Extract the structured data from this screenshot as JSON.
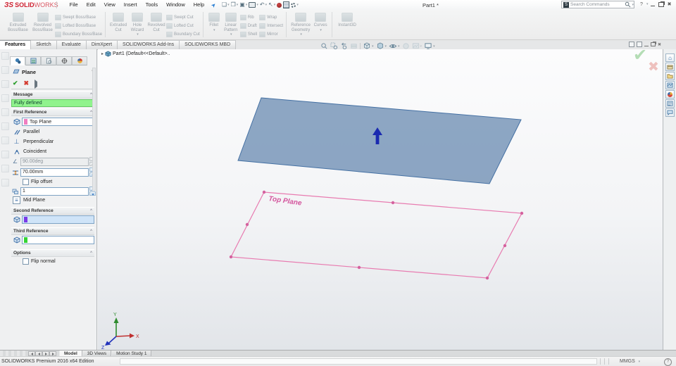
{
  "titlebar": {
    "logo_text_bold": "SOLID",
    "logo_text_light": "WORKS",
    "menus": {
      "file": "File",
      "edit": "Edit",
      "view": "View",
      "insert": "Insert",
      "tools": "Tools",
      "window": "Window",
      "help": "Help"
    },
    "document_title": "Part1 *",
    "search_placeholder": "Search Commands"
  },
  "ribbon": {
    "g1b1l1": "Extruded",
    "g1b1l2": "Boss/Base",
    "g1b2l1": "Revolved",
    "g1b2l2": "Boss/Base",
    "g1s1": "Swept Boss/Base",
    "g1s2": "Lofted Boss/Base",
    "g1s3": "Boundary Boss/Base",
    "g2b1l1": "Extruded",
    "g2b1l2": "Cut",
    "g2b2l1": "Hole",
    "g2b2l2": "Wizard",
    "g2b3l1": "Revolved",
    "g2b3l2": "Cut",
    "g2s1": "Swept Cut",
    "g2s2": "Lofted Cut",
    "g2s3": "Boundary Cut",
    "g3b1": "Fillet",
    "g3b2l1": "Linear",
    "g3b2l2": "Pattern",
    "g3s1": "Rib",
    "g3s2": "Draft",
    "g3s3": "Shell",
    "g3t1": "Wrap",
    "g3t2": "Intersect",
    "g3t3": "Mirror",
    "g4b1l1": "Reference",
    "g4b1l2": "Geometry",
    "g4b2": "Curves",
    "g5b1": "Instant3D"
  },
  "command_tabs": {
    "t1": "Features",
    "t2": "Sketch",
    "t3": "Evaluate",
    "t4": "DimXpert",
    "t5": "SOLIDWORKS Add-Ins",
    "t6": "SOLIDWORKS MBD"
  },
  "property_manager": {
    "title": "Plane",
    "message_header": "Message",
    "message_text": "Fully defined",
    "first_reference_header": "First Reference",
    "first_reference_value": "Top Plane",
    "parallel": "Parallel",
    "perpendicular": "Perpendicular",
    "coincident": "Coincident",
    "angle_value": "90.00deg",
    "distance_value": "70.00mm",
    "flip_offset": "Flip offset",
    "count_value": "1",
    "mid_plane": "Mid Plane",
    "second_reference_header": "Second Reference",
    "third_reference_header": "Third Reference",
    "options_header": "Options",
    "flip_normal": "Flip normal"
  },
  "feature_tree": {
    "root": "Part1  (Default<<Default>.."
  },
  "viewport": {
    "plane_label": "Top Plane",
    "axis_x": "X",
    "axis_y": "Y",
    "axis_z": "Z"
  },
  "bottom_tabs": {
    "model": "Model",
    "views3d": "3D Views",
    "motion": "Motion Study 1"
  },
  "status_bar": {
    "edition": "SOLIDWORKS Premium 2016 x64 Edition",
    "units": "MMGS"
  },
  "icons": {
    "collapse": "^",
    "dropdown": "▾",
    "flyout": "▸",
    "ok": "✔",
    "cancel": "✖",
    "help": "?",
    "perpendicular_glyph": "⊥",
    "angle_glyph": "∠",
    "midplane_glyph": "≡",
    "close": "✖",
    "undo": "↶",
    "select": "↖",
    "new": "❏",
    "open": "❒",
    "save": "▣",
    "logo_mark": "ЗS",
    "search_badge": "S",
    "home": "⌂",
    "pin": "➤"
  },
  "colors": {
    "message_green": "#90f38d",
    "selection_pink": "#f07ec0",
    "selection_purple": "#7a3ae8",
    "selection_green": "#35d435",
    "plane_fill_blue": "#7d9abb",
    "plane_edge_blue": "#4470a3",
    "outline_pink": "#e87bb0",
    "logo_red": "#cf2030"
  }
}
